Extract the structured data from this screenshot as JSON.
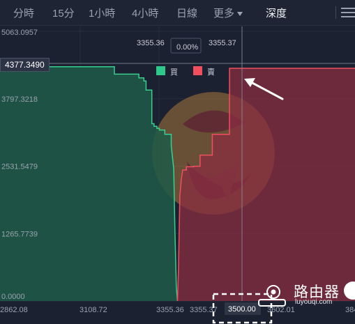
{
  "toolbar": {
    "tabs": [
      "分時",
      "15分",
      "1小時",
      "4小時",
      "日線",
      "更多",
      "深度"
    ],
    "active_tab": "深度"
  },
  "header": {
    "bid_price": "3355.36",
    "spread_pct": "0.00%",
    "ask_price": "3355.37"
  },
  "cursor_price": "4377.3490",
  "legend": {
    "buy_label": "買",
    "sell_label": "賣",
    "buy_color": "#2ec98a",
    "sell_color": "#f0505e"
  },
  "highlight_label": "3500.00",
  "watermark": {
    "text": "路由器",
    "subtext": "luyouqi.com"
  },
  "chart_data": {
    "type": "area",
    "y_tick_labels": [
      "5063.0957",
      "3797.3218",
      "2531.5479",
      "1265.7739",
      "0.0000"
    ],
    "x_tick_labels": [
      "2862.08",
      "3108.72",
      "3355.36",
      "3355.37",
      "3500.00",
      "3602.01",
      "384"
    ],
    "xlim": [
      2862.08,
      3848.66
    ],
    "ylim": [
      0,
      5063.0957
    ],
    "series": [
      {
        "name": "買",
        "x": [
          2862.08,
          2998,
          2998,
          3180,
          3180,
          3248,
          3248,
          3262,
          3262,
          3268,
          3268,
          3284,
          3284,
          3290,
          3290,
          3298,
          3298,
          3305,
          3305,
          3320,
          3320,
          3338,
          3338,
          3345,
          3348,
          3352,
          3355.36
        ],
        "y": [
          4520,
          4520,
          4400,
          4400,
          4260,
          4260,
          4190,
          4190,
          4130,
          4130,
          3960,
          3960,
          3330,
          3330,
          3280,
          3280,
          3240,
          3240,
          3210,
          3210,
          3130,
          3130,
          2920,
          2480,
          1390,
          260,
          0
        ]
      },
      {
        "name": "賣",
        "x": [
          3355.37,
          3358,
          3362,
          3366,
          3370,
          3380,
          3380,
          3400,
          3400,
          3418,
          3418,
          3452,
          3452,
          3500,
          3500,
          3848.66
        ],
        "y": [
          0,
          620,
          1980,
          2290,
          2460,
          2460,
          2520,
          2520,
          2530,
          2530,
          2740,
          2740,
          3130,
          3130,
          4370,
          4370
        ]
      }
    ],
    "grid": true,
    "legend_position": "top-center"
  }
}
